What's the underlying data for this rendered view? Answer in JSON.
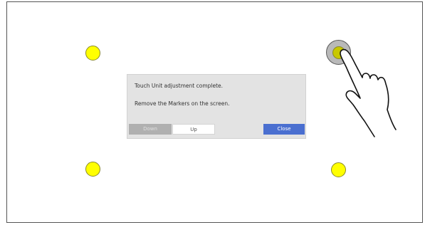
{
  "dialog": {
    "message_line1": "Touch Unit adjustment complete.",
    "message_line2": "Remove the Markers on the screen.",
    "down_label": "Down",
    "up_label": "Up",
    "close_label": "Close"
  },
  "markers": [
    {
      "name": "marker-top-left",
      "state": "pending"
    },
    {
      "name": "marker-top-right",
      "state": "touched"
    },
    {
      "name": "marker-bottom-left",
      "state": "pending"
    },
    {
      "name": "marker-bottom-right",
      "state": "pending"
    }
  ],
  "icons": {
    "hand": "pointing-hand-icon"
  },
  "colors": {
    "marker_fill": "#ffff00",
    "marker_touched_fill": "#c8c800",
    "dialog_bg": "#e3e3e3",
    "close_button": "#4a6fd0"
  }
}
